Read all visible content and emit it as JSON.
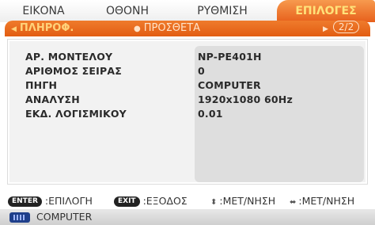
{
  "tabs": [
    {
      "label": "ΕΙΚΟΝΑ",
      "active": false
    },
    {
      "label": "ΟΘΟΝΗ",
      "active": false
    },
    {
      "label": "ΡΥΘΜΙΣΗ",
      "active": false
    },
    {
      "label": "ΕΠΙΛΟΓΕΣ",
      "active": true
    }
  ],
  "subtabs": {
    "active_label": "ΠΛΗΡΟΦ.",
    "other_label": "ΠΡΟΣΘΕΤΑ",
    "page": "2/2"
  },
  "info": {
    "rows": [
      {
        "label": "ΑΡ. ΜΟΝΤΕΛΟΥ",
        "value": "NP-PE401H"
      },
      {
        "label": "ΑΡΙΘΜΟΣ ΣΕΙΡΑΣ",
        "value": "0"
      },
      {
        "label": "ΠΗΓΗ",
        "value": "COMPUTER"
      },
      {
        "label": "ΑΝΑΛΥΣΗ",
        "value": "1920x1080 60Hz"
      },
      {
        "label": "ΕΚΔ. ΛΟΓΙΣΜΙΚΟΥ",
        "value": "0.01"
      }
    ]
  },
  "help": {
    "enter_key": "ENTER",
    "enter_text": ":ΕΠΙΛΟΓΗ",
    "exit_key": "EXIT",
    "exit_text": ":ΕΞΟΔΟΣ",
    "updown_text": ":ΜΕΤ/ΝΗΣΗ",
    "leftright_text": ":ΜΕΤ/ΝΗΣΗ"
  },
  "source": {
    "icon": "computer-source-icon",
    "label": "COMPUTER"
  },
  "colors": {
    "accent": "#e7601c",
    "accent_text": "#ffe27a"
  }
}
